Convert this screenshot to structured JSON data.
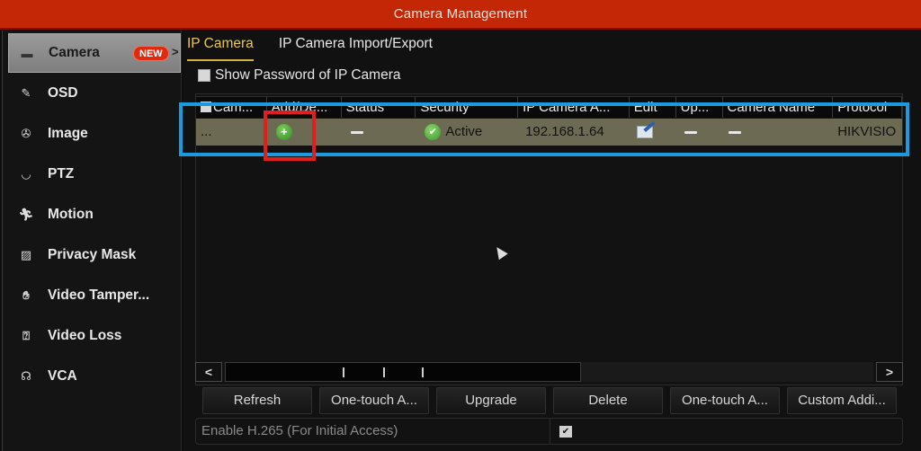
{
  "window": {
    "title": "Camera Management"
  },
  "sidebar": {
    "items": [
      {
        "label": "Camera",
        "icon": "camera-icon",
        "active": true,
        "badge": "NEW",
        "arrow": ">"
      },
      {
        "label": "OSD",
        "icon": "osd-icon",
        "active": false
      },
      {
        "label": "Image",
        "icon": "image-icon",
        "active": false
      },
      {
        "label": "PTZ",
        "icon": "ptz-icon",
        "active": false
      },
      {
        "label": "Motion",
        "icon": "motion-icon",
        "active": false
      },
      {
        "label": "Privacy Mask",
        "icon": "privacy-mask-icon",
        "active": false
      },
      {
        "label": "Video Tamper...",
        "icon": "hand-icon",
        "active": false
      },
      {
        "label": "Video Loss",
        "icon": "video-loss-icon",
        "active": false
      },
      {
        "label": "VCA",
        "icon": "vca-icon",
        "active": false
      }
    ]
  },
  "tabs": [
    {
      "label": "IP Camera",
      "active": true
    },
    {
      "label": "IP Camera Import/Export",
      "active": false
    }
  ],
  "show_password": {
    "label": "Show Password of IP Camera",
    "checked": false
  },
  "table": {
    "columns": [
      "Cam...",
      "Add/De...",
      "Status",
      "Security",
      "IP Camera A...",
      "Edit",
      "Up...",
      "Camera Name",
      "Protocol"
    ],
    "rows": [
      {
        "camera_no": "...",
        "add_delete": "add-icon",
        "status": "—",
        "security": "Active",
        "ip_address": "192.168.1.64",
        "edit": "edit-icon",
        "upgrade": "—",
        "camera_name": "—",
        "protocol": "HIKVISIO"
      }
    ]
  },
  "scrollbar": {
    "left": "<",
    "right": ">"
  },
  "buttons": [
    "Refresh",
    "One-touch A...",
    "Upgrade",
    "Delete",
    "One-touch A...",
    "Custom Addi..."
  ],
  "h265": {
    "label": "Enable H.265 (For Initial Access)",
    "checked": true,
    "check_glyph": "✔"
  },
  "colors": {
    "title_bar": "#c42706",
    "active_tab": "#e8c84a",
    "selected_row": "#6c6a52",
    "annotation_blue": "#1a9be0",
    "annotation_red": "#e01e1e"
  }
}
